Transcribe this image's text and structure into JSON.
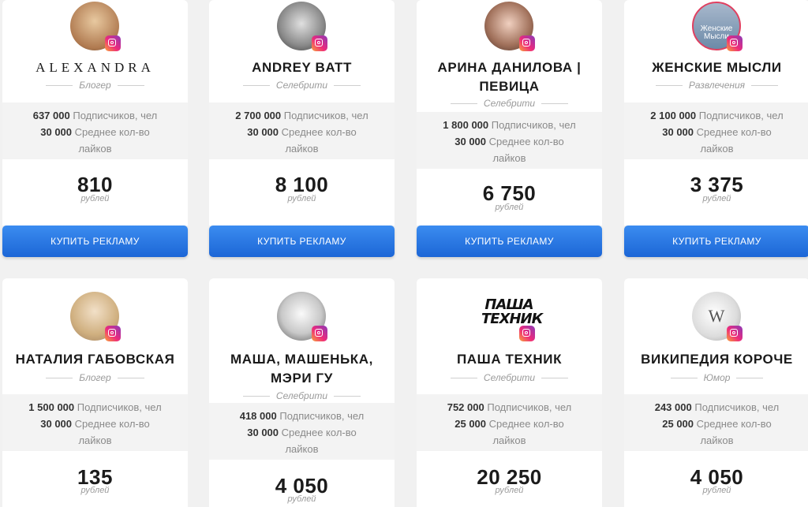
{
  "buy_label": "КУПИТЬ РЕКЛАМУ",
  "subs_suffix": "Подписчиков, чел",
  "likes_suffix": "Среднее кол-во лайков",
  "currency": "рублей",
  "cards": [
    {
      "name": "ALEXANDRA",
      "category": "Блогер",
      "subs": "637 000",
      "likes": "30 000",
      "price": "810",
      "avatar_color": "#c8a07a"
    },
    {
      "name": "ANDREY BATT",
      "category": "Селебрити",
      "subs": "2 700 000",
      "likes": "30 000",
      "price": "8 100",
      "avatar_color": "#5a5a5a"
    },
    {
      "name": "АРИНА ДАНИЛОВА | ПЕВИЦА",
      "category": "Селебрити",
      "subs": "1 800 000",
      "likes": "30 000",
      "price": "6 750",
      "avatar_color": "#8b6a5a"
    },
    {
      "name": "ЖЕНСКИЕ МЫСЛИ",
      "category": "Развлечения",
      "subs": "2 100 000",
      "likes": "30 000",
      "price": "3 375",
      "avatar_color": "#7a8fa8",
      "avatar_text": "Женские Мысли"
    },
    {
      "name": "НАТАЛИЯ ГАБОВСКАЯ",
      "category": "Блогер",
      "subs": "1 500 000",
      "likes": "30 000",
      "price": "135",
      "avatar_color": "#d8c3a0"
    },
    {
      "name": "МАША, МАШЕНЬКА, МЭРИ ГУ",
      "category": "Селебрити",
      "subs": "418 000",
      "likes": "30 000",
      "price": "4 050",
      "avatar_color": "#d9d9d9"
    },
    {
      "name": "ПАША ТЕХНИК",
      "category": "Селебрити",
      "subs": "752 000",
      "likes": "25 000",
      "price": "20 250",
      "avatar_text": "ПАША ТЕХНИК"
    },
    {
      "name": "ВИКИПЕДИЯ КОРОЧЕ",
      "category": "Юмор",
      "subs": "243 000",
      "likes": "25 000",
      "price": "4 050",
      "avatar_color": "#e6e6e6"
    }
  ]
}
